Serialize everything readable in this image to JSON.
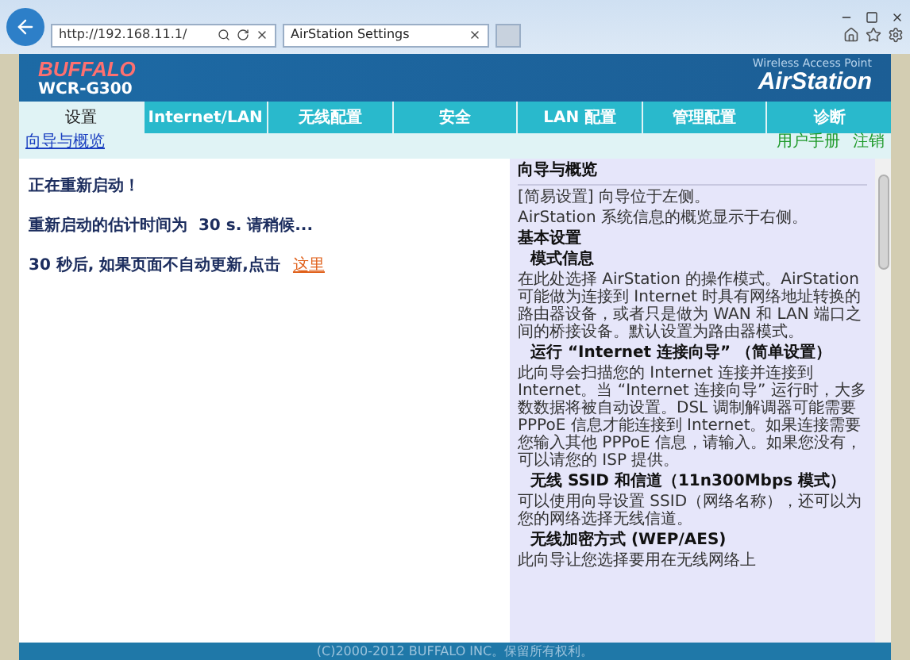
{
  "browser": {
    "address": "http://192.168.11.1/",
    "tab_title": "AirStation Settings"
  },
  "header": {
    "brand": "BUFFALO",
    "model": "WCR-G300",
    "tagline": "Wireless Access Point",
    "product": "AirStation"
  },
  "tabs": [
    {
      "label": "设置",
      "selected": true
    },
    {
      "label": "Internet/LAN",
      "selected": false
    },
    {
      "label": "无线配置",
      "selected": false
    },
    {
      "label": "安全",
      "selected": false
    },
    {
      "label": "LAN 配置",
      "selected": false
    },
    {
      "label": "管理配置",
      "selected": false
    },
    {
      "label": "诊断",
      "selected": false
    }
  ],
  "subnav": {
    "link": "向导与概览",
    "right_links": [
      "用户手册",
      "注销"
    ]
  },
  "main": [
    {
      "text": "正在重新启动！"
    },
    {
      "text": "重新启动的估计时间为  30 s. 请稍候..."
    },
    {
      "text": "30 秒后, 如果页面不自动更新,点击",
      "link": "这里"
    }
  ],
  "help": {
    "title": "向导与概览",
    "items": [
      {
        "kind": "text",
        "text": "[简易设置] 向导位于左侧。"
      },
      {
        "kind": "text",
        "text": "AirStation 系统信息的概览显示于右侧。"
      },
      {
        "kind": "heading",
        "text": "基本设置"
      },
      {
        "kind": "subheading",
        "text": "模式信息"
      },
      {
        "kind": "text",
        "text": "在此处选择 AirStation 的操作模式。AirStation 可能做为连接到 Internet 时具有网络地址转换的路由器设备，或者只是做为 WAN 和 LAN 端口之间的桥接设备。默认设置为路由器模式。"
      },
      {
        "kind": "subheading",
        "text": "运行 “Internet 连接向导” （简单设置）"
      },
      {
        "kind": "text",
        "text": "此向导会扫描您的 Internet 连接并连接到 Internet。当 “Internet 连接向导” 运行时，大多数数据将被自动设置。DSL 调制解调器可能需要 PPPoE 信息才能连接到 Internet。如果连接需要您输入其他 PPPoE 信息，请输入。如果您没有，可以请您的 ISP 提供。"
      },
      {
        "kind": "subheading",
        "text": "无线 SSID 和信道（11n300Mbps 模式）"
      },
      {
        "kind": "text",
        "text": "可以使用向导设置 SSID（网络名称），还可以为您的网络选择无线信道。"
      },
      {
        "kind": "subheading",
        "text": "无线加密方式 (WEP/AES)"
      },
      {
        "kind": "text",
        "text": "此向导让您选择要用在无线网络上"
      }
    ]
  },
  "footer": "(C)2000-2012 BUFFALO INC。保留所有权利。"
}
